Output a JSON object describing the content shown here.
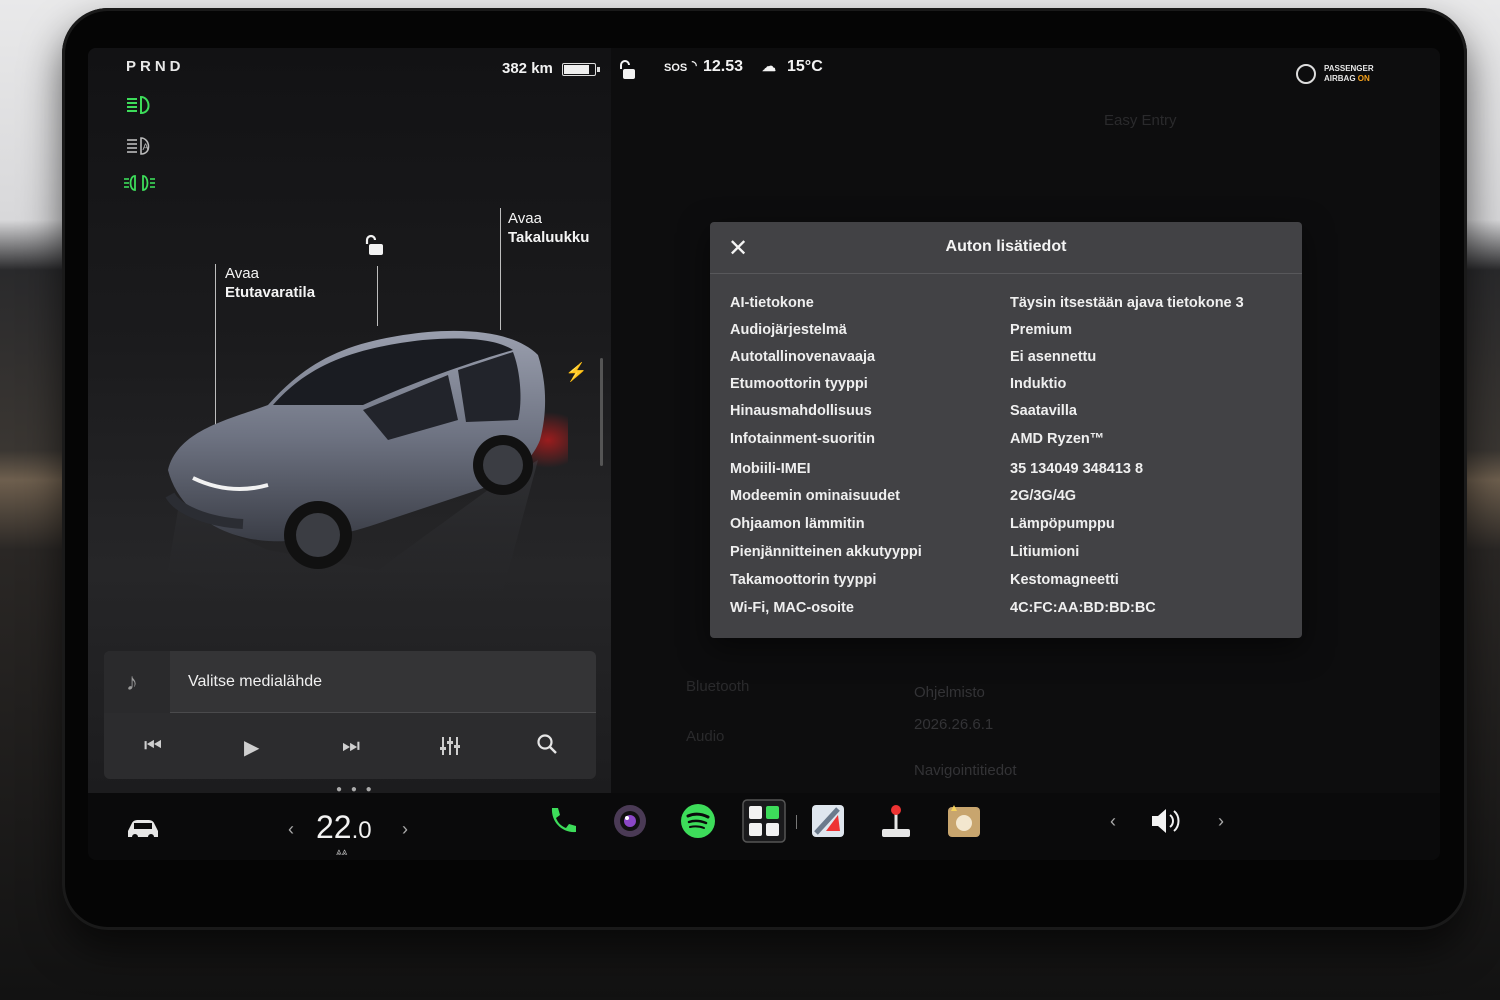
{
  "status": {
    "gear": "PRND",
    "range": "382 km",
    "battery_level": 0.82,
    "sos": "SOS",
    "time": "12.53",
    "temperature": "15°C",
    "airbag_line1": "PASSENGER",
    "airbag_line2": "AIRBAG",
    "airbag_state": "ON"
  },
  "car_view": {
    "frunk_line1": "Avaa",
    "frunk_line2": "Etutavaratila",
    "trunk_line1": "Avaa",
    "trunk_line2": "Takaluukku"
  },
  "background_menu": {
    "easy_entry": "Easy Entry",
    "bluetooth": "Bluetooth",
    "audio": "Audio",
    "software_heading": "Ohjelmisto",
    "software_version": "2026.26.6.1",
    "nav_info": "Navigointitiedot"
  },
  "modal": {
    "title": "Auton lisätiedot",
    "close_icon": "close-icon",
    "rows": [
      {
        "key": "AI-tietokone",
        "value": "Täysin itsestään ajava tietokone 3"
      },
      {
        "key": "Audiojärjestelmä",
        "value": "Premium"
      },
      {
        "key": "Autotallinovenavaaja",
        "value": "Ei asennettu"
      },
      {
        "key": "Etumoottorin tyyppi",
        "value": "Induktio"
      },
      {
        "key": "Hinausmahdollisuus",
        "value": "Saatavilla"
      },
      {
        "key": "Infotainment-suoritin",
        "value": "AMD Ryzen™"
      },
      {
        "key": "Mobiili-IMEI",
        "value": "35 134049 348413 8"
      },
      {
        "key": "Modeemin ominaisuudet",
        "value": "2G/3G/4G"
      },
      {
        "key": "Ohjaamon lämmitin",
        "value": "Lämpöpumppu"
      },
      {
        "key": "Pienjännitteinen akkutyyppi",
        "value": "Litiumioni"
      },
      {
        "key": "Takamoottorin tyyppi",
        "value": "Kestomagneetti"
      },
      {
        "key": "Wi-Fi, MAC-osoite",
        "value": "4C:FC:AA:BD:BD:BC"
      }
    ]
  },
  "media": {
    "source_label": "Valitse medialähde"
  },
  "climate": {
    "temp_int": "22",
    "temp_dec": ".0"
  },
  "colors": {
    "accent_green": "#3ddc5a",
    "airbag_on": "#f6a21b",
    "modal_bg": "#424245"
  }
}
